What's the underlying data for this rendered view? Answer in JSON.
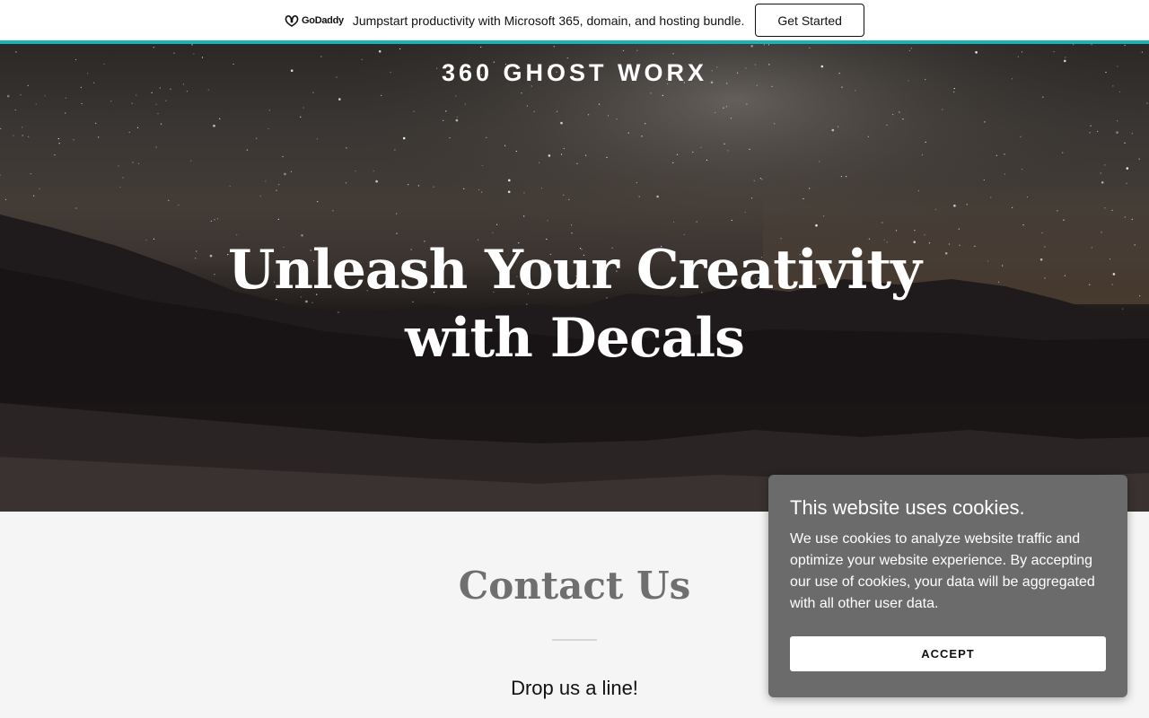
{
  "promo": {
    "logo_text": "GoDaddy",
    "message": "Jumpstart productivity with Microsoft 365, domain, and hosting bundle.",
    "cta_label": "Get Started",
    "accent_color": "#1bb1b5"
  },
  "header": {
    "site_title": "360 GHOST WORX"
  },
  "hero": {
    "heading": "Unleash Your Creativity with Decals",
    "background": "night sky with milky way over mountains and lake"
  },
  "contact": {
    "title": "Contact Us",
    "subtitle": "Drop us a line!"
  },
  "cookie_banner": {
    "title": "This website uses cookies.",
    "body": "We use cookies to analyze website traffic and optimize your website experience. By accepting our use of cookies, your data will be aggregated with all other user data.",
    "accept_label": "ACCEPT"
  }
}
